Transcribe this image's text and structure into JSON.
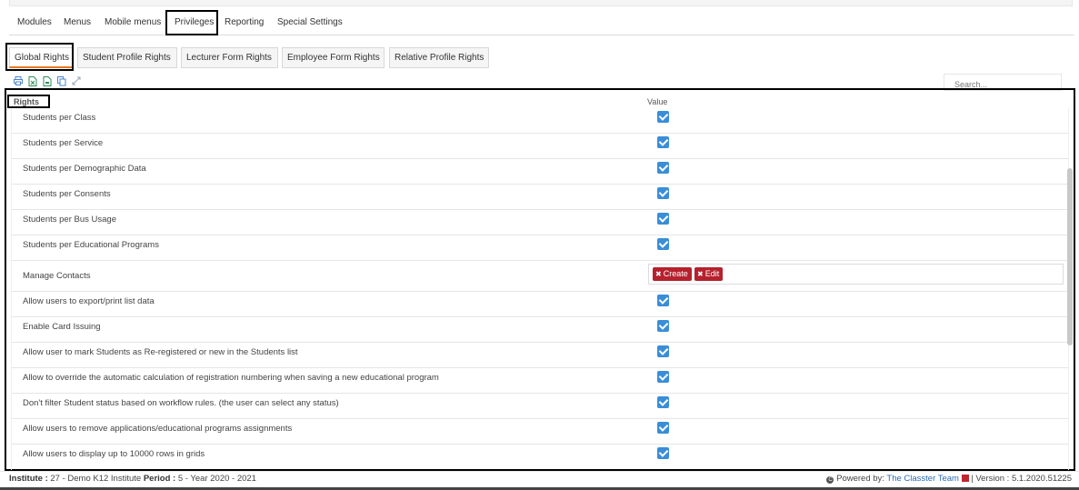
{
  "main_tabs": [
    {
      "label": "Modules"
    },
    {
      "label": "Menus"
    },
    {
      "label": "Mobile menus"
    },
    {
      "label": "Privileges"
    },
    {
      "label": "Reporting"
    },
    {
      "label": "Special Settings"
    }
  ],
  "sub_tabs": [
    {
      "label": "Global Rights"
    },
    {
      "label": "Student Profile Rights"
    },
    {
      "label": "Lecturer Form Rights"
    },
    {
      "label": "Employee Form Rights"
    },
    {
      "label": "Relative Profile Rights"
    }
  ],
  "toolbar_icons": [
    "print-icon",
    "excel-icon",
    "csv-icon",
    "copy-icon",
    "expand-icon"
  ],
  "search": {
    "placeholder": "Search..."
  },
  "grid": {
    "col_rights": "Rights",
    "col_value": "Value",
    "rows": [
      {
        "label": "Students per Class",
        "checked": true
      },
      {
        "label": "Students per Service",
        "checked": true
      },
      {
        "label": "Students per Demographic Data",
        "checked": true
      },
      {
        "label": "Students per Consents",
        "checked": true
      },
      {
        "label": "Students per Bus Usage",
        "checked": true
      },
      {
        "label": "Students per Educational Programs",
        "checked": true
      },
      {
        "label": "Manage Contacts",
        "tags": [
          "Create",
          "Edit"
        ]
      },
      {
        "label": "Allow users to export/print list data",
        "checked": true
      },
      {
        "label": "Enable Card Issuing",
        "checked": true
      },
      {
        "label": "Allow user to mark Students as Re-registered or new in the Students list",
        "checked": true
      },
      {
        "label": "Allow to override the automatic calculation of registration numbering when saving a new educational program",
        "checked": true
      },
      {
        "label": "Don't filter Student status based on workflow rules. (the user can select any status)",
        "checked": true
      },
      {
        "label": "Allow users to remove applications/educational programs assignments",
        "checked": true
      },
      {
        "label": "Allow users to display up to 10000 rows in grids",
        "checked": true
      }
    ]
  },
  "footer": {
    "institute_label": "Institute :",
    "institute_value": " 27 - Demo K12 Institute ",
    "period_label": "Period :",
    "period_value": " 5 - Year 2020 - 2021",
    "powered_by": " Powered by: ",
    "brand": "The Classter Team",
    "version": " | Version : 5.1.2020.51225"
  },
  "colors": {
    "accent": "#3a8ed8",
    "tag": "#b5212d",
    "tab_underline": "#e87722"
  }
}
